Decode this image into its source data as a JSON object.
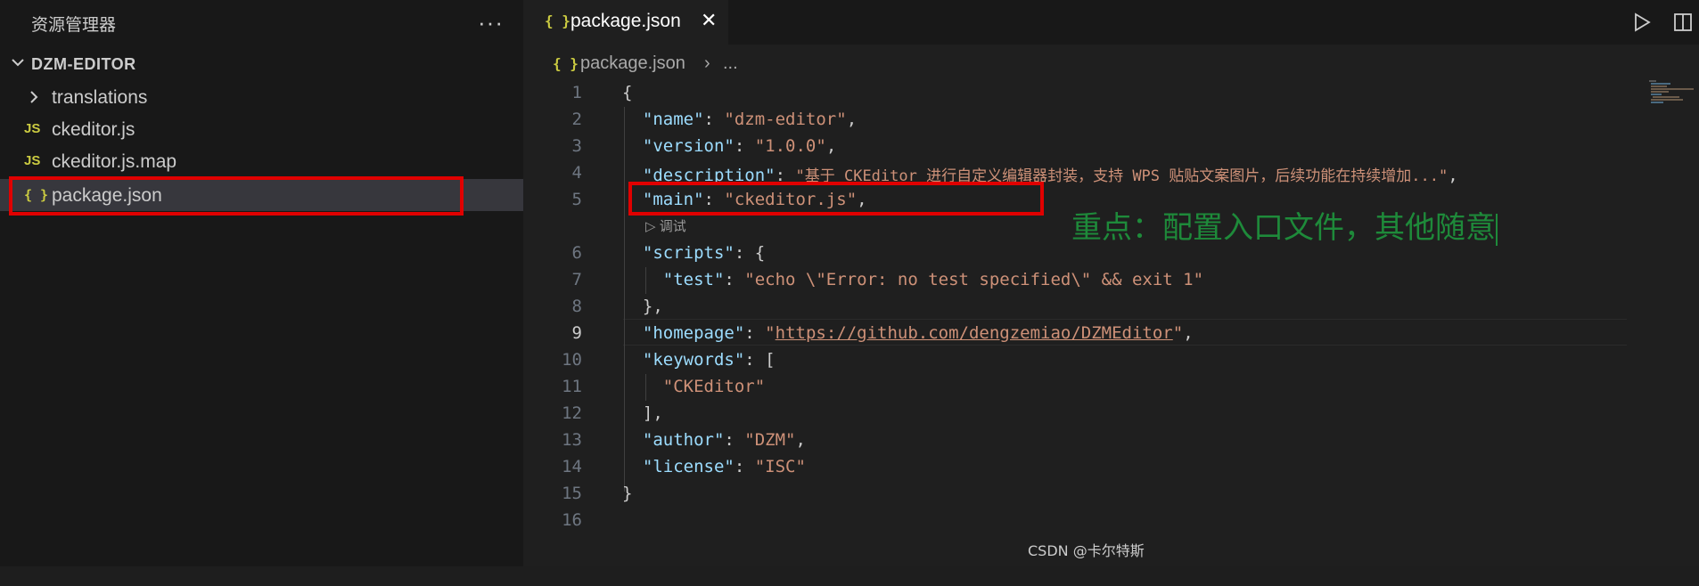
{
  "sidebar": {
    "title": "资源管理器",
    "more": "···",
    "section_title": "DZM-EDITOR",
    "items": [
      {
        "label": "translations",
        "icon": ""
      },
      {
        "label": "ckeditor.js",
        "icon": "JS"
      },
      {
        "label": "ckeditor.js.map",
        "icon": "JS"
      },
      {
        "label": "package.json",
        "icon": "{ }"
      }
    ]
  },
  "editor": {
    "tab": {
      "label": "package.json",
      "icon": "{ }",
      "close": "✕"
    },
    "breadcrumb": {
      "icon": "{ }",
      "file": "package.json",
      "separator": "›",
      "more": "..."
    },
    "lines": [
      {
        "n": "1",
        "text": "{"
      },
      {
        "n": "2",
        "key": "\"name\"",
        "sep": ": ",
        "val": "\"dzm-editor\"",
        "end": ","
      },
      {
        "n": "3",
        "key": "\"version\"",
        "sep": ": ",
        "val": "\"1.0.0\"",
        "end": ","
      },
      {
        "n": "4",
        "key": "\"description\"",
        "sep": ": ",
        "val": "\"基于 CKEditor 进行自定义编辑器封装，支持 WPS 贴贴文案图片，后续功能在持续增加...\"",
        "end": ","
      },
      {
        "n": "5",
        "key": "\"main\"",
        "sep": ": ",
        "val": "\"ckeditor.js\"",
        "end": ","
      },
      {
        "n": "6",
        "key": "\"scripts\"",
        "sep": ": ",
        "end": "{"
      },
      {
        "n": "7",
        "key": "\"test\"",
        "sep": ": ",
        "val": "\"echo \\\"Error: no test specified\\\" && exit 1\"",
        "end": ""
      },
      {
        "n": "8",
        "text": "},"
      },
      {
        "n": "9",
        "key": "\"homepage\"",
        "sep": ": ",
        "val_pre": "\"",
        "val_link": "https://github.com/dengzemiao/DZMEditor",
        "val_post": "\"",
        "end": ","
      },
      {
        "n": "10",
        "key": "\"keywords\"",
        "sep": ": ",
        "end": "["
      },
      {
        "n": "11",
        "val": "\"CKEditor\""
      },
      {
        "n": "12",
        "text": "],"
      },
      {
        "n": "13",
        "key": "\"author\"",
        "sep": ": ",
        "val": "\"DZM\"",
        "end": ","
      },
      {
        "n": "14",
        "key": "\"license\"",
        "sep": ": ",
        "val": "\"ISC\"",
        "end": ""
      },
      {
        "n": "15",
        "text": "}"
      },
      {
        "n": "16",
        "text": ""
      }
    ],
    "codelens": "▷ 调试",
    "annotation": "重点：配置入口文件，其他随意"
  },
  "watermark": "CSDN @卡尔特斯",
  "colors": {
    "key": "#9cdcfe",
    "string": "#ce9178",
    "highlight_box": "#e00000",
    "annotation": "#1e8a3a"
  }
}
